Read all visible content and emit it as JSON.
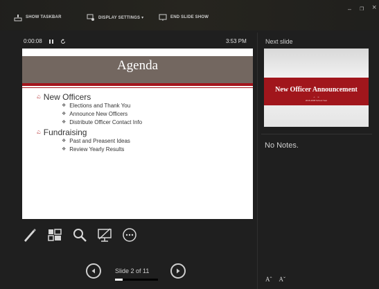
{
  "toolbar": {
    "show_taskbar": "SHOW TASKBAR",
    "display_settings": "DISPLAY SETTINGS ▾",
    "end_slide_show": "END SLIDE SHOW"
  },
  "window": {
    "minimize": "–",
    "restore": "❐",
    "close": "×"
  },
  "timer": {
    "elapsed": "0:00:08",
    "pause_icon": "pause-icon",
    "reset_icon": "reset-icon"
  },
  "clock": "3:53 PM",
  "current_slide": {
    "title": "Agenda",
    "bullets": [
      {
        "text": "New Officers",
        "subitems": [
          "Elections and Thank You",
          "Announce New Officers",
          "Distribute Officer Contact Info"
        ]
      },
      {
        "text": "Fundraising",
        "subitems": [
          "Past and Preasent Ideas",
          "Review Yearly Results"
        ]
      }
    ],
    "marker": "ಎ"
  },
  "tools": [
    "pen-icon",
    "see-all-slides-icon",
    "zoom-icon",
    "black-screen-icon",
    "more-options-icon"
  ],
  "navigation": {
    "label": "Slide 2 of 11",
    "current": 2,
    "total": 11
  },
  "next_slide": {
    "heading": "Next slide",
    "title": "New Officer Announcement",
    "subtitle": "2016-2008 School Year"
  },
  "notes": "No Notes.",
  "font_size": {
    "increase": "Aˆ",
    "decrease": "Aˇ"
  },
  "colors": {
    "accent_red": "#a3161d",
    "title_bar": "#736760",
    "background": "#1f1f1f"
  }
}
